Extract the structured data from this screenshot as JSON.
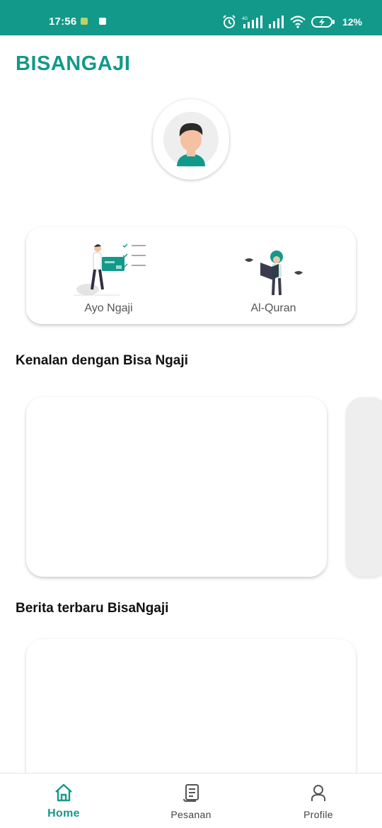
{
  "status_bar": {
    "time": "17:56",
    "battery": "12%",
    "network": "4G",
    "background_color": "#13998a"
  },
  "app": {
    "title": "BISANGAJI",
    "accent_color": "#13998a"
  },
  "profile": {
    "avatar_icon": "user-avatar-icon"
  },
  "menu": {
    "items": [
      {
        "label": "Ayo Ngaji",
        "icon": "checklist-illustration"
      },
      {
        "label": "Al-Quran",
        "icon": "reading-quran-illustration"
      }
    ]
  },
  "sections": {
    "intro_title": "Kenalan dengan Bisa Ngaji",
    "news_title": "Berita terbaru BisaNgaji"
  },
  "bottom_nav": {
    "items": [
      {
        "label": "Home",
        "icon": "home-icon",
        "active": true
      },
      {
        "label": "Pesanan",
        "icon": "receipt-icon",
        "active": false
      },
      {
        "label": "Profile",
        "icon": "person-icon",
        "active": false
      }
    ]
  }
}
